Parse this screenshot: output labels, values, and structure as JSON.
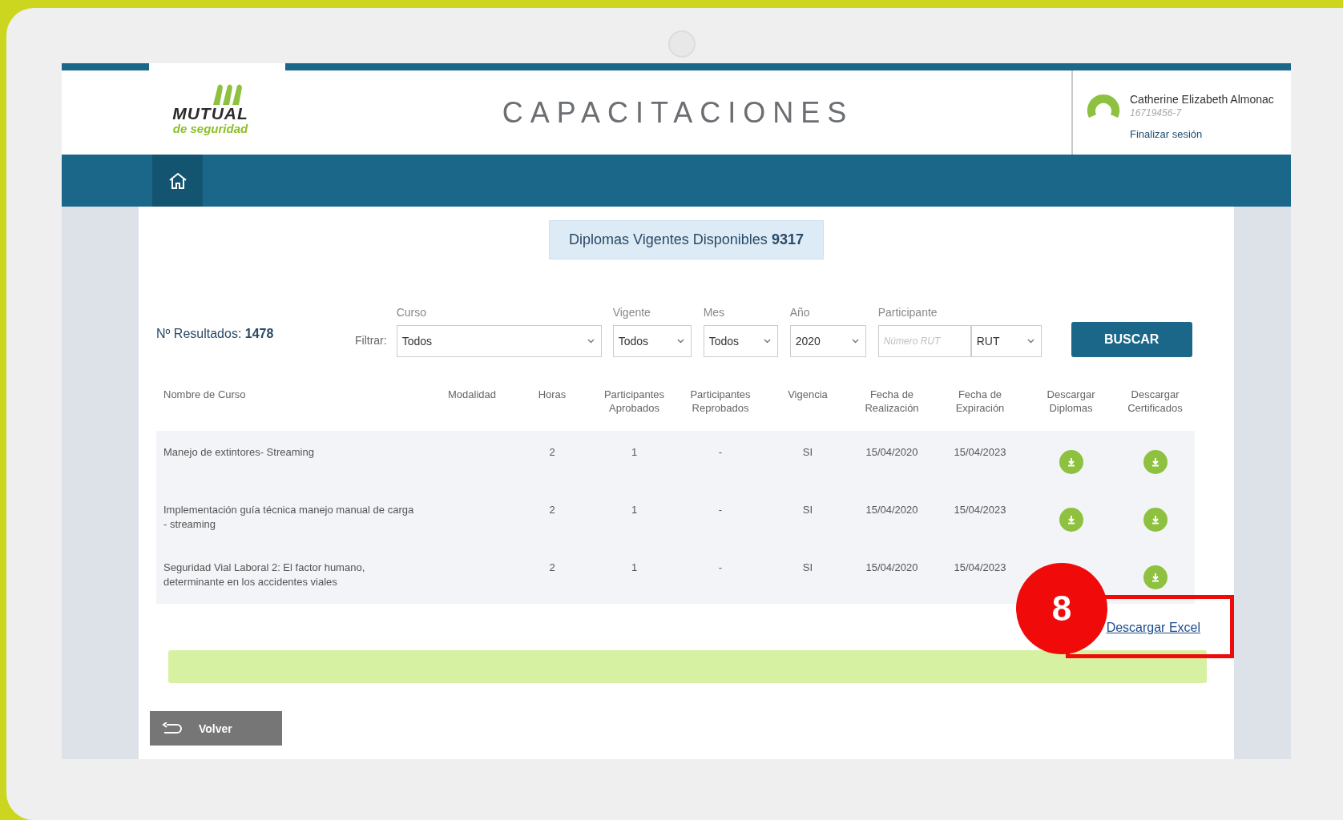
{
  "header": {
    "logo_word": "MUTUAL",
    "logo_sub": "de seguridad",
    "title": "CAPACITACIONES",
    "user_name": "Catherine Elizabeth Almonac",
    "user_rut": "16719456-7",
    "logout": "Finalizar sesión"
  },
  "summary": {
    "label": "Diplomas Vigentes Disponibles",
    "count": "9317"
  },
  "results": {
    "label": "Nº Resultados:",
    "count": "1478"
  },
  "filters": {
    "label": "Filtrar:",
    "fields": [
      {
        "label": "Curso",
        "value": "Todos",
        "kind": "select"
      },
      {
        "label": "Vigente",
        "value": "Todos",
        "kind": "select"
      },
      {
        "label": "Mes",
        "value": "Todos",
        "kind": "select"
      },
      {
        "label": "Año",
        "value": "2020",
        "kind": "select"
      },
      {
        "label": "Participante",
        "placeholder": "Número RUT",
        "kind": "input"
      },
      {
        "value": "RUT",
        "kind": "select"
      }
    ],
    "button": "BUSCAR"
  },
  "table": {
    "columns": [
      "Nombre de Curso",
      "Modalidad",
      "Horas",
      "Participantes Aprobados",
      "Participantes Reprobados",
      "Vigencia",
      "Fecha de Realización",
      "Fecha de Expiración",
      "Descargar Diplomas",
      "Descargar Certificados"
    ],
    "rows": [
      {
        "name": "Manejo de extintores- Streaming",
        "hours": "2",
        "approved": "1",
        "failed": "-",
        "valid": "SI",
        "done": "15/04/2020",
        "expires": "15/04/2023",
        "diploma_icon": true,
        "certificate_icon": true
      },
      {
        "name": "Implementación guía técnica manejo manual de carga - streaming",
        "hours": "2",
        "approved": "1",
        "failed": "-",
        "valid": "SI",
        "done": "15/04/2020",
        "expires": "15/04/2023",
        "diploma_icon": true,
        "certificate_icon": true
      },
      {
        "name": "Seguridad Vial Laboral 2: El factor humano, determinante en los accidentes viales",
        "hours": "2",
        "approved": "1",
        "failed": "-",
        "valid": "SI",
        "done": "15/04/2020",
        "expires": "15/04/2023",
        "diploma_icon": false,
        "certificate_icon": true
      }
    ]
  },
  "excel_link": "Descargar Excel",
  "back_button": "Volver",
  "annotation": {
    "step": "8"
  }
}
